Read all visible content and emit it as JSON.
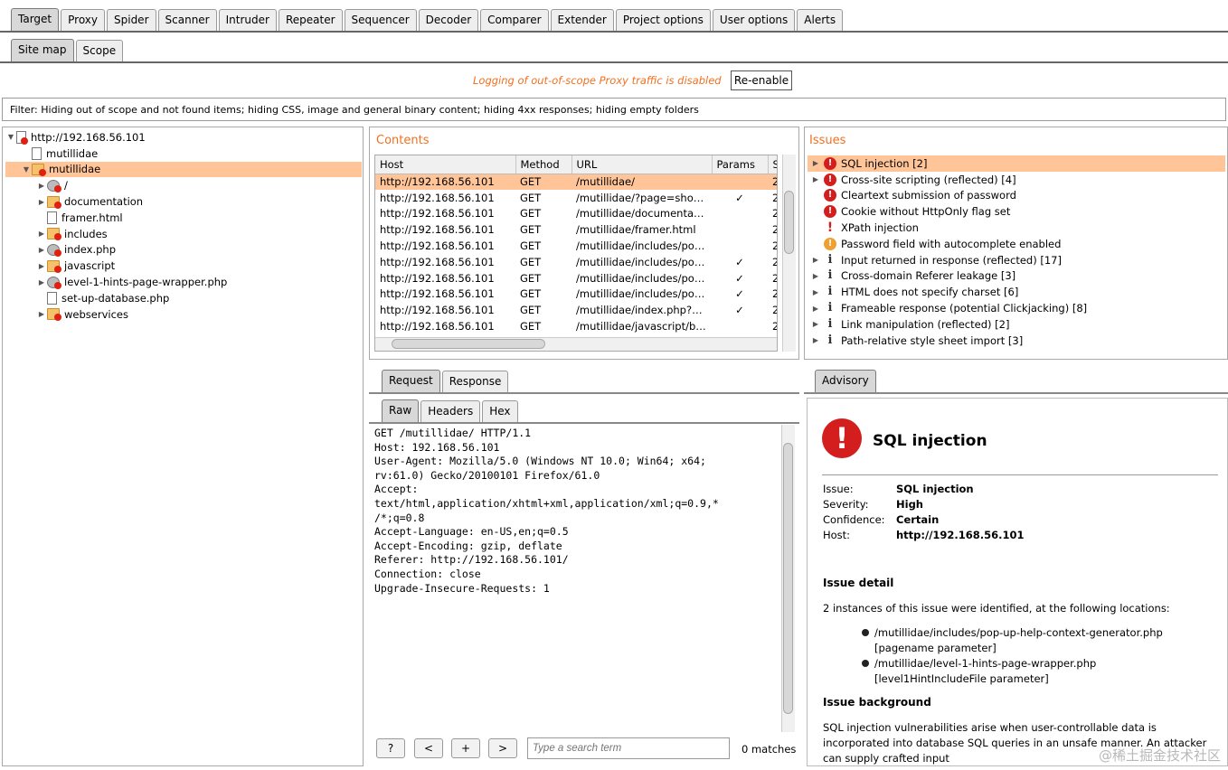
{
  "main_tabs": [
    "Target",
    "Proxy",
    "Spider",
    "Scanner",
    "Intruder",
    "Repeater",
    "Sequencer",
    "Decoder",
    "Comparer",
    "Extender",
    "Project options",
    "User options",
    "Alerts"
  ],
  "sub_tabs": [
    "Site map",
    "Scope"
  ],
  "logging": {
    "message": "Logging of out-of-scope Proxy traffic is disabled",
    "reenable_label": "Re-enable"
  },
  "filter_text": "Filter: Hiding out of scope and not found items;  hiding CSS, image and general binary content;  hiding 4xx responses;  hiding empty folders",
  "tree": [
    {
      "label": "http://192.168.56.101",
      "indent": 0,
      "expander": "▼",
      "icon": "host-icon"
    },
    {
      "label": "mutillidae",
      "indent": 1,
      "expander": "",
      "icon": "file-icon"
    },
    {
      "label": "mutillidae",
      "indent": 1,
      "expander": "▼",
      "icon": "folder-icon",
      "selected": true
    },
    {
      "label": "/",
      "indent": 2,
      "expander": "▶",
      "icon": "gear-icon"
    },
    {
      "label": "documentation",
      "indent": 2,
      "expander": "▶",
      "icon": "folder-icon"
    },
    {
      "label": "framer.html",
      "indent": 2,
      "expander": "",
      "icon": "file-icon"
    },
    {
      "label": "includes",
      "indent": 2,
      "expander": "▶",
      "icon": "folder-icon"
    },
    {
      "label": "index.php",
      "indent": 2,
      "expander": "▶",
      "icon": "gear-icon"
    },
    {
      "label": "javascript",
      "indent": 2,
      "expander": "▶",
      "icon": "folder-icon"
    },
    {
      "label": "level-1-hints-page-wrapper.php",
      "indent": 2,
      "expander": "▶",
      "icon": "gear-icon"
    },
    {
      "label": "set-up-database.php",
      "indent": 2,
      "expander": "",
      "icon": "file-icon"
    },
    {
      "label": "webservices",
      "indent": 2,
      "expander": "▶",
      "icon": "folder-icon"
    }
  ],
  "contents": {
    "title": "Contents",
    "columns": [
      "Host",
      "Method",
      "URL",
      "Params",
      "S"
    ],
    "rows": [
      {
        "host": "http://192.168.56.101",
        "method": "GET",
        "url": "/mutillidae/",
        "params": "",
        "s": "2",
        "selected": true
      },
      {
        "host": "http://192.168.56.101",
        "method": "GET",
        "url": "/mutillidae/?page=show-l...",
        "params": "✓",
        "s": "2"
      },
      {
        "host": "http://192.168.56.101",
        "method": "GET",
        "url": "/mutillidae/documentation...",
        "params": "",
        "s": "2"
      },
      {
        "host": "http://192.168.56.101",
        "method": "GET",
        "url": "/mutillidae/framer.html",
        "params": "",
        "s": "2"
      },
      {
        "host": "http://192.168.56.101",
        "method": "GET",
        "url": "/mutillidae/includes/pop-u...",
        "params": "",
        "s": "2"
      },
      {
        "host": "http://192.168.56.101",
        "method": "GET",
        "url": "/mutillidae/includes/pop-u...",
        "params": "✓",
        "s": "2"
      },
      {
        "host": "http://192.168.56.101",
        "method": "GET",
        "url": "/mutillidae/includes/pop-u...",
        "params": "✓",
        "s": "2"
      },
      {
        "host": "http://192.168.56.101",
        "method": "GET",
        "url": "/mutillidae/includes/pop-u...",
        "params": "✓",
        "s": "2"
      },
      {
        "host": "http://192.168.56.101",
        "method": "GET",
        "url": "/mutillidae/index.php?pag...",
        "params": "✓",
        "s": "2"
      },
      {
        "host": "http://192.168.56.101",
        "method": "GET",
        "url": "/mutillidae/javascript/boo...",
        "params": "",
        "s": "2"
      }
    ]
  },
  "issues": {
    "title": "Issues",
    "items": [
      {
        "label": "SQL injection [2]",
        "severity": "high",
        "expander": "▶",
        "selected": true
      },
      {
        "label": "Cross-site scripting (reflected) [4]",
        "severity": "high",
        "expander": "▶"
      },
      {
        "label": "Cleartext submission of password",
        "severity": "high",
        "expander": ""
      },
      {
        "label": "Cookie without HttpOnly flag set",
        "severity": "high",
        "expander": ""
      },
      {
        "label": "XPath injection",
        "severity": "bang",
        "expander": ""
      },
      {
        "label": "Password field with autocomplete enabled",
        "severity": "low",
        "expander": ""
      },
      {
        "label": "Input returned in response (reflected) [17]",
        "severity": "info",
        "expander": "▶"
      },
      {
        "label": "Cross-domain Referer leakage [3]",
        "severity": "info",
        "expander": "▶"
      },
      {
        "label": "HTML does not specify charset [6]",
        "severity": "info",
        "expander": "▶"
      },
      {
        "label": "Frameable response (potential Clickjacking) [8]",
        "severity": "info",
        "expander": "▶"
      },
      {
        "label": "Link manipulation (reflected) [2]",
        "severity": "info",
        "expander": "▶"
      },
      {
        "label": "Path-relative style sheet import [3]",
        "severity": "info",
        "expander": "▶"
      }
    ]
  },
  "req_tabs": [
    "Request",
    "Response"
  ],
  "view_tabs": [
    "Raw",
    "Headers",
    "Hex"
  ],
  "request_lines": [
    "GET /mutillidae/ HTTP/1.1",
    "Host: 192.168.56.101",
    "User-Agent: Mozilla/5.0 (Windows NT 10.0; Win64; x64;",
    "rv:61.0) Gecko/20100101 Firefox/61.0",
    "Accept:",
    "text/html,application/xhtml+xml,application/xml;q=0.9,*",
    "/*;q=0.8",
    "Accept-Language: en-US,en;q=0.5",
    "Accept-Encoding: gzip, deflate",
    "Referer: http://192.168.56.101/",
    "Connection: close",
    "Upgrade-Insecure-Requests: 1"
  ],
  "search": {
    "help": "?",
    "prev": "<",
    "add": "+",
    "next": ">",
    "placeholder": "Type a search term",
    "matches": "0 matches"
  },
  "advisory": {
    "tab": "Advisory",
    "title": "SQL injection",
    "fields": [
      {
        "k": "Issue:",
        "v": "SQL injection"
      },
      {
        "k": "Severity:",
        "v": "High"
      },
      {
        "k": "Confidence:",
        "v": "Certain"
      },
      {
        "k": "Host:",
        "v": "http://192.168.56.101"
      }
    ],
    "detail_heading": "Issue detail",
    "detail_text": "2 instances of this issue were identified, at the following locations:",
    "locations": [
      "/mutillidae/includes/pop-up-help-context-generator.php [pagename parameter]",
      "/mutillidae/level-1-hints-page-wrapper.php [level1HintIncludeFile parameter]"
    ],
    "background_heading": "Issue background",
    "background_text": "SQL injection vulnerabilities arise when user-controllable data is incorporated into database SQL queries in an unsafe manner. An attacker can supply crafted input"
  },
  "watermark": "@稀土掘金技术社区"
}
